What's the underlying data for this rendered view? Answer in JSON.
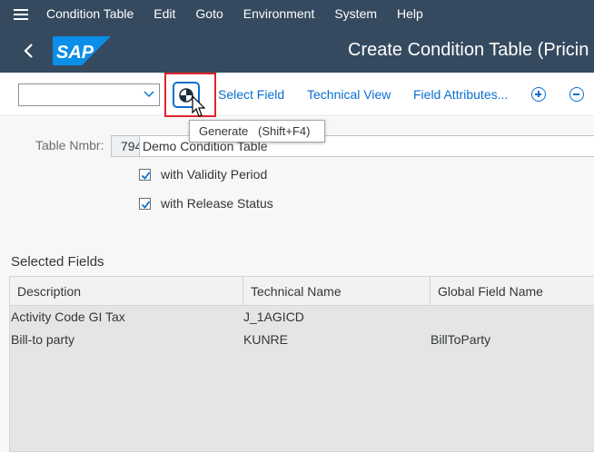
{
  "menu": {
    "items": [
      "Condition Table",
      "Edit",
      "Goto",
      "Environment",
      "System",
      "Help"
    ]
  },
  "shell": {
    "logo_text": "SAP",
    "title": "Create Condition Table (Pricin"
  },
  "toolbar": {
    "dropdown_value": "",
    "generate_tooltip": "Generate   (Shift+F4)",
    "select_field": "Select Field",
    "technical_view": "Technical View",
    "field_attributes": "Field Attributes..."
  },
  "form": {
    "table_nmbr_label": "Table Nmbr:",
    "table_nmbr_value": "794",
    "description_value": "Demo Condition Table",
    "validity_label": "with Validity Period",
    "validity_checked": true,
    "release_label": "with Release Status",
    "release_checked": true
  },
  "selected_fields": {
    "title": "Selected Fields",
    "columns": [
      "Description",
      "Technical Name",
      "Global Field Name"
    ],
    "rows": [
      {
        "description": "Activity Code GI Tax",
        "technical_name": "J_1AGICD",
        "global_field_name": ""
      },
      {
        "description": "Bill-to party",
        "technical_name": "KUNRE",
        "global_field_name": "BillToParty"
      }
    ]
  },
  "colors": {
    "shell_bg": "#354a5f",
    "accent": "#0a6ed1",
    "highlight": "#e0242b"
  }
}
